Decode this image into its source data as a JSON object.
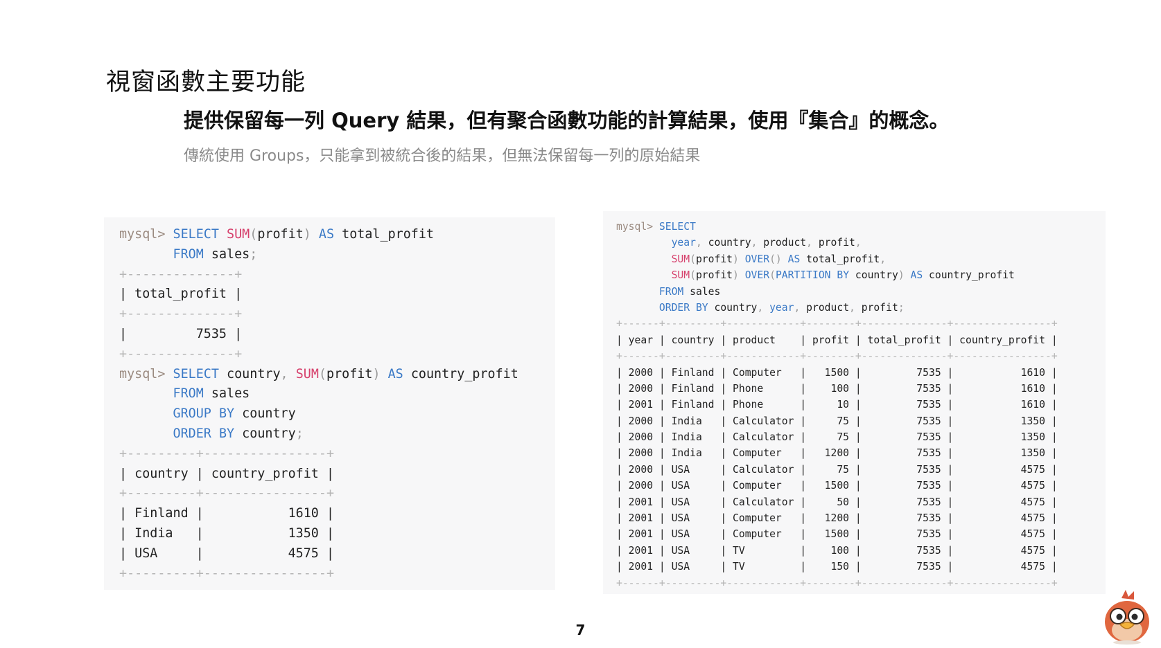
{
  "slide": {
    "title": "視窗函數主要功能",
    "subtitle": "提供保留每一列 Query 結果，但有聚合函數功能的計算結果，使用『集合』的概念。",
    "note": "傳統使用 Groups，只能拿到被統合後的結果，但無法保留每一列的原始結果",
    "page_number": "7"
  },
  "colors": {
    "keyword": "#3a79c6",
    "function": "#d6406c",
    "prompt": "#9a8a80",
    "panel_bg": "#f7f7f8",
    "note_text": "#8a8a8a"
  },
  "icons": {
    "mascot": "cartoon-bird-mascot-icon"
  },
  "left_code": [
    [
      [
        "p",
        "mysql> "
      ],
      [
        "k",
        "SELECT "
      ],
      [
        "f",
        "SUM"
      ],
      [
        "d",
        "("
      ],
      [
        "t",
        "profit"
      ],
      [
        "d",
        ") "
      ],
      [
        "k",
        "AS "
      ],
      [
        "t",
        "total_profit"
      ]
    ],
    [
      [
        "t",
        "       "
      ],
      [
        "k",
        "FROM "
      ],
      [
        "t",
        "sales"
      ],
      [
        "d",
        ";"
      ]
    ],
    [
      [
        "b",
        "+--------------+"
      ]
    ],
    [
      [
        "t",
        "| total_profit |"
      ]
    ],
    [
      [
        "b",
        "+--------------+"
      ]
    ],
    [
      [
        "t",
        "|         7535 |"
      ]
    ],
    [
      [
        "b",
        "+--------------+"
      ]
    ],
    [
      [
        "p",
        "mysql> "
      ],
      [
        "k",
        "SELECT "
      ],
      [
        "t",
        "country"
      ],
      [
        "d",
        ", "
      ],
      [
        "f",
        "SUM"
      ],
      [
        "d",
        "("
      ],
      [
        "t",
        "profit"
      ],
      [
        "d",
        ") "
      ],
      [
        "k",
        "AS "
      ],
      [
        "t",
        "country_profit"
      ]
    ],
    [
      [
        "t",
        "       "
      ],
      [
        "k",
        "FROM "
      ],
      [
        "t",
        "sales"
      ]
    ],
    [
      [
        "t",
        "       "
      ],
      [
        "k",
        "GROUP BY "
      ],
      [
        "t",
        "country"
      ]
    ],
    [
      [
        "t",
        "       "
      ],
      [
        "k",
        "ORDER BY "
      ],
      [
        "t",
        "country"
      ],
      [
        "d",
        ";"
      ]
    ],
    [
      [
        "b",
        "+---------+----------------+"
      ]
    ],
    [
      [
        "t",
        "| country | country_profit |"
      ]
    ],
    [
      [
        "b",
        "+---------+----------------+"
      ]
    ],
    [
      [
        "t",
        "| Finland |           1610 |"
      ]
    ],
    [
      [
        "t",
        "| India   |           1350 |"
      ]
    ],
    [
      [
        "t",
        "| USA     |           4575 |"
      ]
    ],
    [
      [
        "b",
        "+---------+----------------+"
      ]
    ]
  ],
  "right_code": [
    [
      [
        "p",
        "mysql> "
      ],
      [
        "k",
        "SELECT"
      ]
    ],
    [
      [
        "t",
        "         "
      ],
      [
        "k",
        "year"
      ],
      [
        "d",
        ", "
      ],
      [
        "t",
        "country"
      ],
      [
        "d",
        ", "
      ],
      [
        "t",
        "product"
      ],
      [
        "d",
        ", "
      ],
      [
        "t",
        "profit"
      ],
      [
        "d",
        ","
      ]
    ],
    [
      [
        "t",
        "         "
      ],
      [
        "f",
        "SUM"
      ],
      [
        "d",
        "("
      ],
      [
        "t",
        "profit"
      ],
      [
        "d",
        ") "
      ],
      [
        "k",
        "OVER"
      ],
      [
        "d",
        "() "
      ],
      [
        "k",
        "AS "
      ],
      [
        "t",
        "total_profit"
      ],
      [
        "d",
        ","
      ]
    ],
    [
      [
        "t",
        "         "
      ],
      [
        "f",
        "SUM"
      ],
      [
        "d",
        "("
      ],
      [
        "t",
        "profit"
      ],
      [
        "d",
        ") "
      ],
      [
        "k",
        "OVER"
      ],
      [
        "d",
        "("
      ],
      [
        "k",
        "PARTITION BY "
      ],
      [
        "t",
        "country"
      ],
      [
        "d",
        ") "
      ],
      [
        "k",
        "AS "
      ],
      [
        "t",
        "country_profit"
      ]
    ],
    [
      [
        "t",
        "       "
      ],
      [
        "k",
        "FROM "
      ],
      [
        "t",
        "sales"
      ]
    ],
    [
      [
        "t",
        "       "
      ],
      [
        "k",
        "ORDER BY "
      ],
      [
        "t",
        "country"
      ],
      [
        "d",
        ", "
      ],
      [
        "k",
        "year"
      ],
      [
        "d",
        ", "
      ],
      [
        "t",
        "product"
      ],
      [
        "d",
        ", "
      ],
      [
        "t",
        "profit"
      ],
      [
        "d",
        ";"
      ]
    ],
    [
      [
        "b",
        "+------+---------+------------+--------+--------------+----------------+"
      ]
    ],
    [
      [
        "t",
        "| year | country | product    | profit | total_profit | country_profit |"
      ]
    ],
    [
      [
        "b",
        "+------+---------+------------+--------+--------------+----------------+"
      ]
    ],
    [
      [
        "t",
        "| 2000 | Finland | Computer   |   1500 |         7535 |           1610 |"
      ]
    ],
    [
      [
        "t",
        "| 2000 | Finland | Phone      |    100 |         7535 |           1610 |"
      ]
    ],
    [
      [
        "t",
        "| 2001 | Finland | Phone      |     10 |         7535 |           1610 |"
      ]
    ],
    [
      [
        "t",
        "| 2000 | India   | Calculator |     75 |         7535 |           1350 |"
      ]
    ],
    [
      [
        "t",
        "| 2000 | India   | Calculator |     75 |         7535 |           1350 |"
      ]
    ],
    [
      [
        "t",
        "| 2000 | India   | Computer   |   1200 |         7535 |           1350 |"
      ]
    ],
    [
      [
        "t",
        "| 2000 | USA     | Calculator |     75 |         7535 |           4575 |"
      ]
    ],
    [
      [
        "t",
        "| 2000 | USA     | Computer   |   1500 |         7535 |           4575 |"
      ]
    ],
    [
      [
        "t",
        "| 2001 | USA     | Calculator |     50 |         7535 |           4575 |"
      ]
    ],
    [
      [
        "t",
        "| 2001 | USA     | Computer   |   1200 |         7535 |           4575 |"
      ]
    ],
    [
      [
        "t",
        "| 2001 | USA     | Computer   |   1500 |         7535 |           4575 |"
      ]
    ],
    [
      [
        "t",
        "| 2001 | USA     | TV         |    100 |         7535 |           4575 |"
      ]
    ],
    [
      [
        "t",
        "| 2001 | USA     | TV         |    150 |         7535 |           4575 |"
      ]
    ],
    [
      [
        "b",
        "+------+---------+------------+--------+--------------+----------------+"
      ]
    ]
  ]
}
